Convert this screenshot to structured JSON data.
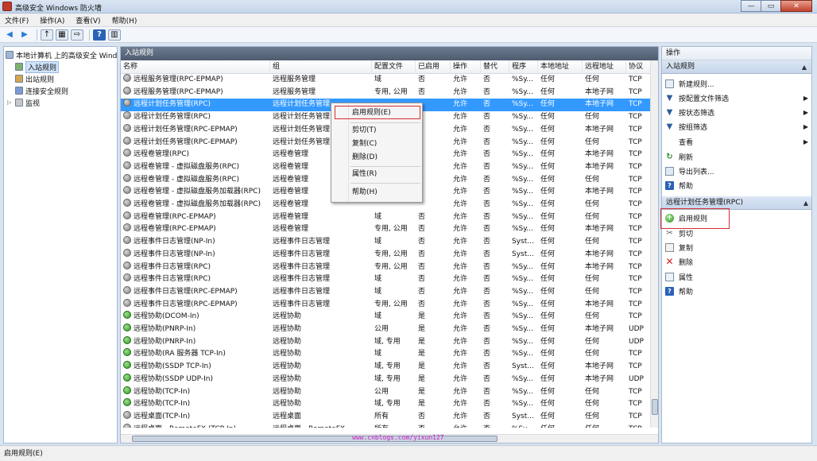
{
  "window": {
    "title": "高级安全 Windows 防火墙",
    "minimize": "—",
    "maximize": "▭",
    "close": "✕"
  },
  "menu": [
    "文件(F)",
    "操作(A)",
    "查看(V)",
    "帮助(H)"
  ],
  "tree": {
    "root": "本地计算机 上的高级安全 Windows",
    "items": [
      "入站规则",
      "出站规则",
      "连接安全规则",
      "监视"
    ]
  },
  "center": {
    "title": "入站规则",
    "columns": [
      "名称",
      "组",
      "配置文件",
      "已启用",
      "操作",
      "替代",
      "程序",
      "本地地址",
      "远程地址",
      "协议"
    ],
    "rows": [
      {
        "name": "远程服务管理(RPC-EPMAP)",
        "group": "远程服务管理",
        "profile": "域",
        "enabled": "否",
        "action": "允许",
        "override": "否",
        "program": "%Sy...",
        "local": "任何",
        "remote": "任何",
        "protocol": "TCP",
        "on": false
      },
      {
        "name": "远程服务管理(RPC-EPMAP)",
        "group": "远程服务管理",
        "profile": "专用, 公用",
        "enabled": "否",
        "action": "允许",
        "override": "否",
        "program": "%Sy...",
        "local": "任何",
        "remote": "本地子网",
        "protocol": "TCP",
        "on": false
      },
      {
        "name": "远程计划任务管理(RPC)",
        "group": "远程计划任务管理",
        "profile": "",
        "enabled": "",
        "action": "允许",
        "override": "否",
        "program": "%Sy...",
        "local": "任何",
        "remote": "本地子网",
        "protocol": "TCP",
        "on": false
      },
      {
        "name": "远程计划任务管理(RPC)",
        "group": "远程计划任务管理",
        "profile": "",
        "enabled": "",
        "action": "允许",
        "override": "否",
        "program": "%Sy...",
        "local": "任何",
        "remote": "任何",
        "protocol": "TCP",
        "on": false
      },
      {
        "name": "远程计划任务管理(RPC-EPMAP)",
        "group": "远程计划任务管理",
        "profile": "",
        "enabled": "",
        "action": "允许",
        "override": "否",
        "program": "%Sy...",
        "local": "任何",
        "remote": "本地子网",
        "protocol": "TCP",
        "on": false
      },
      {
        "name": "远程计划任务管理(RPC-EPMAP)",
        "group": "远程计划任务管理",
        "profile": "",
        "enabled": "",
        "action": "允许",
        "override": "否",
        "program": "%Sy...",
        "local": "任何",
        "remote": "任何",
        "protocol": "TCP",
        "on": false
      },
      {
        "name": "远程卷管理(RPC)",
        "group": "远程卷管理",
        "profile": "",
        "enabled": "",
        "action": "允许",
        "override": "否",
        "program": "%Sy...",
        "local": "任何",
        "remote": "本地子网",
        "protocol": "TCP",
        "on": false
      },
      {
        "name": "远程卷管理 - 虚拟磁盘服务(RPC)",
        "group": "远程卷管理",
        "profile": "",
        "enabled": "",
        "action": "允许",
        "override": "否",
        "program": "%Sy...",
        "local": "任何",
        "remote": "本地子网",
        "protocol": "TCP",
        "on": false
      },
      {
        "name": "远程卷管理 - 虚拟磁盘服务(RPC)",
        "group": "远程卷管理",
        "profile": "",
        "enabled": "",
        "action": "允许",
        "override": "否",
        "program": "%Sy...",
        "local": "任何",
        "remote": "任何",
        "protocol": "TCP",
        "on": false
      },
      {
        "name": "远程卷管理 - 虚拟磁盘服务加载器(RPC)",
        "group": "远程卷管理",
        "profile": "",
        "enabled": "",
        "action": "允许",
        "override": "否",
        "program": "%Sy...",
        "local": "任何",
        "remote": "本地子网",
        "protocol": "TCP",
        "on": false
      },
      {
        "name": "远程卷管理 - 虚拟磁盘服务加载器(RPC)",
        "group": "远程卷管理",
        "profile": "",
        "enabled": "",
        "action": "允许",
        "override": "否",
        "program": "%Sy...",
        "local": "任何",
        "remote": "任何",
        "protocol": "TCP",
        "on": false
      },
      {
        "name": "远程卷管理(RPC-EPMAP)",
        "group": "远程卷管理",
        "profile": "域",
        "enabled": "否",
        "action": "允许",
        "override": "否",
        "program": "%Sy...",
        "local": "任何",
        "remote": "任何",
        "protocol": "TCP",
        "on": false
      },
      {
        "name": "远程卷管理(RPC-EPMAP)",
        "group": "远程卷管理",
        "profile": "专用, 公用",
        "enabled": "否",
        "action": "允许",
        "override": "否",
        "program": "%Sy...",
        "local": "任何",
        "remote": "本地子网",
        "protocol": "TCP",
        "on": false
      },
      {
        "name": "远程事件日志管理(NP-In)",
        "group": "远程事件日志管理",
        "profile": "域",
        "enabled": "否",
        "action": "允许",
        "override": "否",
        "program": "Syst...",
        "local": "任何",
        "remote": "任何",
        "protocol": "TCP",
        "on": false
      },
      {
        "name": "远程事件日志管理(NP-In)",
        "group": "远程事件日志管理",
        "profile": "专用, 公用",
        "enabled": "否",
        "action": "允许",
        "override": "否",
        "program": "Syst...",
        "local": "任何",
        "remote": "本地子网",
        "protocol": "TCP",
        "on": false
      },
      {
        "name": "远程事件日志管理(RPC)",
        "group": "远程事件日志管理",
        "profile": "专用, 公用",
        "enabled": "否",
        "action": "允许",
        "override": "否",
        "program": "%Sy...",
        "local": "任何",
        "remote": "本地子网",
        "protocol": "TCP",
        "on": false
      },
      {
        "name": "远程事件日志管理(RPC)",
        "group": "远程事件日志管理",
        "profile": "域",
        "enabled": "否",
        "action": "允许",
        "override": "否",
        "program": "%Sy...",
        "local": "任何",
        "remote": "任何",
        "protocol": "TCP",
        "on": false
      },
      {
        "name": "远程事件日志管理(RPC-EPMAP)",
        "group": "远程事件日志管理",
        "profile": "域",
        "enabled": "否",
        "action": "允许",
        "override": "否",
        "program": "%Sy...",
        "local": "任何",
        "remote": "任何",
        "protocol": "TCP",
        "on": false
      },
      {
        "name": "远程事件日志管理(RPC-EPMAP)",
        "group": "远程事件日志管理",
        "profile": "专用, 公用",
        "enabled": "否",
        "action": "允许",
        "override": "否",
        "program": "%Sy...",
        "local": "任何",
        "remote": "本地子网",
        "protocol": "TCP",
        "on": false
      },
      {
        "name": "远程协助(DCOM-In)",
        "group": "远程协助",
        "profile": "域",
        "enabled": "是",
        "action": "允许",
        "override": "否",
        "program": "%Sy...",
        "local": "任何",
        "remote": "任何",
        "protocol": "TCP",
        "on": true
      },
      {
        "name": "远程协助(PNRP-In)",
        "group": "远程协助",
        "profile": "公用",
        "enabled": "是",
        "action": "允许",
        "override": "否",
        "program": "%Sy...",
        "local": "任何",
        "remote": "本地子网",
        "protocol": "UDP",
        "on": true
      },
      {
        "name": "远程协助(PNRP-In)",
        "group": "远程协助",
        "profile": "域, 专用",
        "enabled": "是",
        "action": "允许",
        "override": "否",
        "program": "%Sy...",
        "local": "任何",
        "remote": "任何",
        "protocol": "UDP",
        "on": true
      },
      {
        "name": "远程协助(RA 服务器 TCP-In)",
        "group": "远程协助",
        "profile": "域",
        "enabled": "是",
        "action": "允许",
        "override": "否",
        "program": "%Sy...",
        "local": "任何",
        "remote": "任何",
        "protocol": "TCP",
        "on": true
      },
      {
        "name": "远程协助(SSDP TCP-In)",
        "group": "远程协助",
        "profile": "域, 专用",
        "enabled": "是",
        "action": "允许",
        "override": "否",
        "program": "Syst...",
        "local": "任何",
        "remote": "本地子网",
        "protocol": "TCP",
        "on": true
      },
      {
        "name": "远程协助(SSDP UDP-In)",
        "group": "远程协助",
        "profile": "域, 专用",
        "enabled": "是",
        "action": "允许",
        "override": "否",
        "program": "%Sy...",
        "local": "任何",
        "remote": "本地子网",
        "protocol": "UDP",
        "on": true
      },
      {
        "name": "远程协助(TCP-In)",
        "group": "远程协助",
        "profile": "公用",
        "enabled": "是",
        "action": "允许",
        "override": "否",
        "program": "%Sy...",
        "local": "任何",
        "remote": "任何",
        "protocol": "TCP",
        "on": true
      },
      {
        "name": "远程协助(TCP-In)",
        "group": "远程协助",
        "profile": "域, 专用",
        "enabled": "是",
        "action": "允许",
        "override": "否",
        "program": "%Sy...",
        "local": "任何",
        "remote": "任何",
        "protocol": "TCP",
        "on": true
      },
      {
        "name": "远程桌面(TCP-In)",
        "group": "远程桌面",
        "profile": "所有",
        "enabled": "否",
        "action": "允许",
        "override": "否",
        "program": "Syst...",
        "local": "任何",
        "remote": "任何",
        "protocol": "TCP",
        "on": false
      },
      {
        "name": "远程桌面 - RemoteFX (TCP-In)",
        "group": "远程桌面 - RemoteFX",
        "profile": "所有",
        "enabled": "否",
        "action": "允许",
        "override": "否",
        "program": "%Sy...",
        "local": "任何",
        "remote": "任何",
        "protocol": "TCP",
        "on": false
      }
    ]
  },
  "context_menu": [
    "启用规则(E)",
    "剪切(T)",
    "复制(C)",
    "删除(D)",
    "属性(R)",
    "帮助(H)"
  ],
  "actions": {
    "title": "操作",
    "section1": "入站规则",
    "items1": [
      "新建规则...",
      "按配置文件筛选",
      "按状态筛选",
      "按组筛选",
      "查看",
      "刷新",
      "导出列表...",
      "帮助"
    ],
    "section2": "远程计划任务管理(RPC)",
    "items2": [
      "启用规则",
      "剪切",
      "复制",
      "删除",
      "属性",
      "帮助"
    ]
  },
  "watermark": "www.cnblogs.com/yixun127",
  "statusbar": "启用规则(E)"
}
